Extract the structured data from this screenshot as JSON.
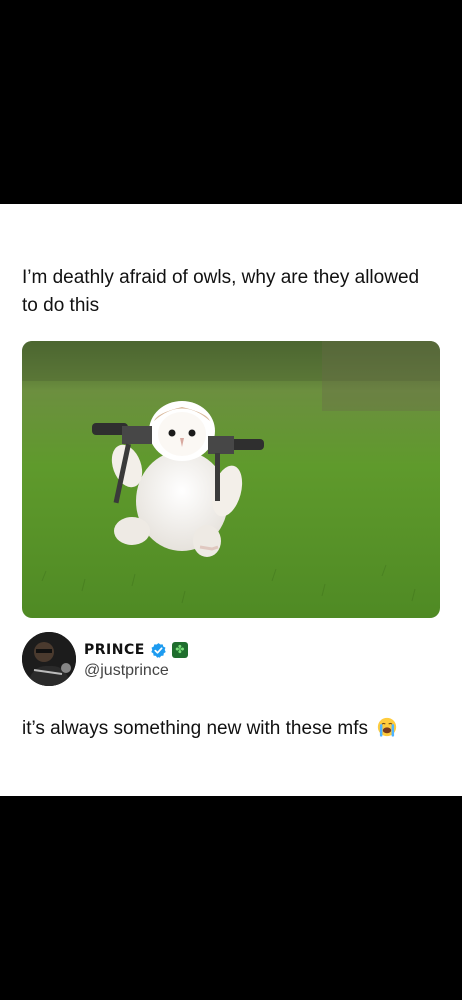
{
  "post": {
    "quote_text": "I’m deathly afraid of owls, why are they allowed to do this",
    "image_icon": "owl-with-guns-photo"
  },
  "author": {
    "display_name": "PRINCE",
    "handle": "@justprince",
    "verified_icon": "verified-badge-icon",
    "badge_icon": "clover-icon",
    "badge_glyph": "✤",
    "avatar_icon": "avatar"
  },
  "reply": {
    "text": "it’s always something new with these mfs",
    "emoji_icon": "loudly-crying-face-icon"
  },
  "colors": {
    "background": "#000000",
    "card": "#ffffff",
    "verified": "#1d9bf0",
    "grass": "#5f9a2c"
  }
}
